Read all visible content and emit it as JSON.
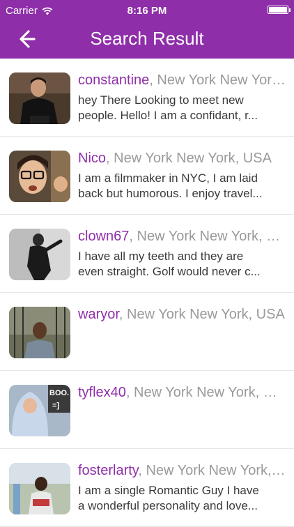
{
  "status_bar": {
    "carrier": "Carrier",
    "time": "8:16 PM"
  },
  "nav": {
    "title": "Search Result"
  },
  "colors": {
    "brand": "#8f2ea9",
    "location": "#9a9a9a",
    "text": "#3a3a3a"
  },
  "results": [
    {
      "username": "constantine",
      "location": ", New York New York, USA",
      "description_lines": [
        "hey There  Looking to meet new",
        "people. Hello! I am a confidant, r..."
      ]
    },
    {
      "username": "Nico",
      "location": ", New York New York, USA",
      "description_lines": [
        "I am a filmmaker in NYC, I am laid",
        "back but humorous. I enjoy travel..."
      ]
    },
    {
      "username": "clown67",
      "location": ", New York New York, USA",
      "description_lines": [
        "I have all my teeth and they are",
        "even straight. Golf would never c..."
      ]
    },
    {
      "username": "waryor",
      "location": ", New York New York, USA",
      "description_lines": []
    },
    {
      "username": "tyflex40",
      "location": ", New York New York, USA",
      "description_lines": [],
      "photo_text": [
        "BOO.",
        "=]"
      ]
    },
    {
      "username": "fosterlarty",
      "location": ", New York New York, USA",
      "description_lines": [
        "I am a single Romantic Guy I have",
        "a wonderful personality and love..."
      ]
    }
  ]
}
